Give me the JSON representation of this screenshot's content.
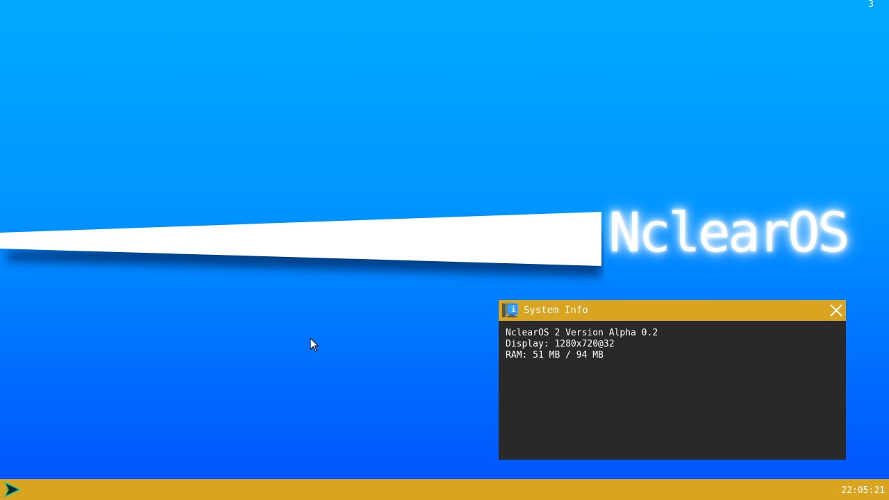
{
  "desktop": {
    "workspace_number": "3",
    "logo_text": "NclearOS",
    "background_top": "#00a9ff",
    "background_bottom": "#0052ff"
  },
  "cursor": {
    "icon": "arrow-cursor-icon"
  },
  "system_info_window": {
    "title": "System Info",
    "icon": "system-info-icon",
    "close_icon": "close-icon",
    "lines": [
      "NclearOS 2 Version Alpha 0.2",
      "Display: 1280x720@32",
      "RAM: 51 MB / 94 MB"
    ]
  },
  "taskbar": {
    "start_icon": "start-arrow-icon",
    "clock": "22:05:21",
    "color": "#d9a520"
  }
}
